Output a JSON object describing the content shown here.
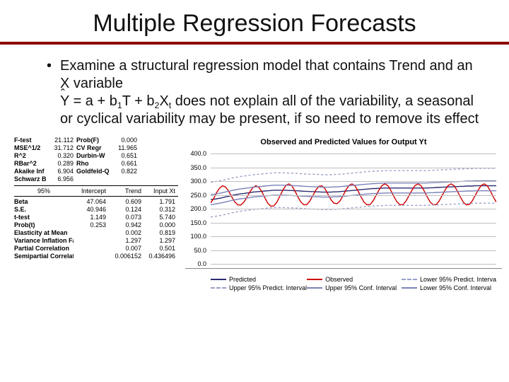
{
  "title": "Multiple Regression Forecasts",
  "bullet": {
    "marker": "•",
    "line1": "Examine a structural regression model that contains Trend and an X variable",
    "eq_yhat": "Y",
    "eq_mid1": " = a + b",
    "eq_sub1": "1",
    "eq_mid2": "T + b",
    "eq_sub2": "2",
    "eq_mid3": "X",
    "eq_sub3": "t",
    "line2_rest": " does not explain all of the variability, a seasonal or cyclical variability may be present, if so need to remove its effect"
  },
  "stats_panel1": [
    {
      "l1": "F-test",
      "v1": "21.112",
      "l2": "Prob(F)",
      "v2": "0.000"
    },
    {
      "l1": "MSE^1/2",
      "v1": "31.712",
      "l2": "CV Regr",
      "v2": "11.965"
    },
    {
      "l1": "R^2",
      "v1": "0.320",
      "l2": "Durbin-W",
      "v2": "0.651"
    },
    {
      "l1": "RBar^2",
      "v1": "0.289",
      "l2": "Rho",
      "v2": "0.661"
    },
    {
      "l1": "Akaike Inf",
      "v1": "6.904",
      "l2": "Goldfeld-Q",
      "v2": "0.822"
    },
    {
      "l1": "Schwarz B",
      "v1": "6.956",
      "l2": "",
      "v2": ""
    }
  ],
  "stats_header": {
    "h1": "95%",
    "h2": "Intercept",
    "h3": "Trend",
    "h4": "Input Xt"
  },
  "stats_panel2": [
    {
      "lab": "Beta",
      "v1": "47.064",
      "v2": "0.609",
      "v3": "1.791"
    },
    {
      "lab": "S.E.",
      "v1": "40.946",
      "v2": "0.124",
      "v3": "0.312"
    },
    {
      "lab": "t-test",
      "v1": "1.149",
      "v2": "0.073",
      "v3": "5.740"
    },
    {
      "lab": "Prob(t)",
      "v1": "0.253",
      "v2": "0.942",
      "v3": "0.000"
    },
    {
      "lab": "Elasticity at Mean",
      "v1": "",
      "v2": "0.002",
      "v3": "0.819"
    },
    {
      "lab": "Variance Inflation Fa",
      "v1": "",
      "v2": "1.297",
      "v3": "1.297"
    },
    {
      "lab": "Partial Correlation",
      "v1": "",
      "v2": "0.007",
      "v3": "0.501"
    },
    {
      "lab": "Semipartial Correlat",
      "v1": "",
      "v2": "0.006152",
      "v3": "0.436496"
    }
  ],
  "chart_data": {
    "type": "line",
    "title": "Observed and Predicted Values for Output Yt",
    "ylabel": "",
    "xlabel": "",
    "ylim": [
      0,
      400
    ],
    "yticks": [
      0,
      50,
      100,
      150,
      200,
      250,
      300,
      350,
      400
    ],
    "x_count": 96,
    "series": [
      {
        "name": "Predicted",
        "color": "#2c2c70",
        "values": [
          233,
          234,
          236,
          238,
          240,
          243,
          245,
          248,
          250,
          252,
          254,
          255,
          257,
          258,
          260,
          261,
          262,
          263,
          264,
          265,
          266,
          267,
          267,
          267,
          267,
          267,
          266,
          266,
          265,
          265,
          264,
          263,
          263,
          262,
          262,
          261,
          261,
          260,
          260,
          260,
          260,
          261,
          261,
          262,
          263,
          264,
          265,
          266,
          267,
          268,
          269,
          270,
          271,
          272,
          273,
          273,
          274,
          274,
          275,
          275,
          275,
          275,
          275,
          275,
          275,
          275,
          275,
          275,
          275,
          275,
          275,
          275,
          275,
          276,
          276,
          277,
          277,
          278,
          278,
          279,
          279,
          280,
          280,
          281,
          281,
          282,
          282,
          282,
          283,
          283,
          283,
          283,
          283,
          283,
          283,
          283
        ]
      },
      {
        "name": "Observed",
        "color": "#d00000",
        "values": [
          221,
          237,
          259,
          275,
          283,
          278,
          263,
          243,
          225,
          214,
          213,
          223,
          240,
          260,
          276,
          283,
          278,
          262,
          240,
          220,
          209,
          210,
          223,
          245,
          267,
          284,
          290,
          283,
          265,
          243,
          224,
          214,
          215,
          228,
          248,
          268,
          281,
          283,
          273,
          253,
          233,
          220,
          218,
          228,
          247,
          268,
          284,
          290,
          283,
          265,
          243,
          224,
          214,
          215,
          228,
          248,
          268,
          284,
          290,
          283,
          265,
          243,
          224,
          214,
          215,
          228,
          248,
          268,
          284,
          290,
          283,
          265,
          243,
          224,
          214,
          215,
          228,
          248,
          268,
          284,
          290,
          283,
          265,
          243,
          224,
          214,
          215,
          228,
          248,
          268,
          284,
          290,
          283,
          265,
          243,
          224
        ]
      },
      {
        "name": "Lower 95% Predict. Interva",
        "color": "#9aa0c8",
        "dash": true,
        "offset": -63
      },
      {
        "name": "Upper 95% Predict. Interval",
        "color": "#9aa0c8",
        "dash": true,
        "offset": 63
      },
      {
        "name": "Lower 95% Conf. Interval",
        "color": "#7a82b8",
        "offset": -18
      },
      {
        "name": "Upper 95% Conf. Interval",
        "color": "#7a82b8",
        "offset": 18
      }
    ],
    "legend_order": [
      "Predicted",
      "Observed",
      "Lower 95% Predict. Interva",
      "Upper 95% Predict. Interval",
      "Upper 95% Conf. Interval",
      "Lower 95% Conf. Interval"
    ]
  }
}
